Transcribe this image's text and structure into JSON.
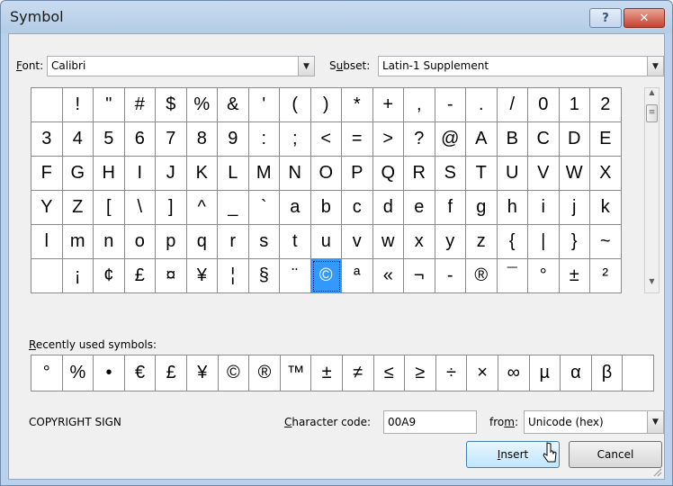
{
  "window": {
    "title": "Symbol",
    "help_glyph": "?",
    "close_glyph": "✕"
  },
  "font": {
    "label_u": "F",
    "label_rest": "ont:",
    "value": "Calibri"
  },
  "subset": {
    "label_pre": "S",
    "label_u": "u",
    "label_rest": "bset:",
    "value": "Latin-1 Supplement"
  },
  "symbol_grid": [
    [
      " ",
      "!",
      "\"",
      "#",
      "$",
      "%",
      "&",
      "'",
      "(",
      ")",
      "*",
      "+",
      ",",
      "-",
      ".",
      "/",
      "0",
      "1",
      "2"
    ],
    [
      "3",
      "4",
      "5",
      "6",
      "7",
      "8",
      "9",
      ":",
      ";",
      "<",
      "=",
      ">",
      "?",
      "@",
      "A",
      "B",
      "C",
      "D",
      "E"
    ],
    [
      "F",
      "G",
      "H",
      "I",
      "J",
      "K",
      "L",
      "M",
      "N",
      "O",
      "P",
      "Q",
      "R",
      "S",
      "T",
      "U",
      "V",
      "W",
      "X"
    ],
    [
      "Y",
      "Z",
      "[",
      "\\",
      "]",
      "^",
      "_",
      "`",
      "a",
      "b",
      "c",
      "d",
      "e",
      "f",
      "g",
      "h",
      "i",
      "j",
      "k"
    ],
    [
      "l",
      "m",
      "n",
      "o",
      "p",
      "q",
      "r",
      "s",
      "t",
      "u",
      "v",
      "w",
      "x",
      "y",
      "z",
      "{",
      "|",
      "}",
      "~"
    ],
    [
      " ",
      "¡",
      "¢",
      "£",
      "¤",
      "¥",
      "¦",
      "§",
      "¨",
      "©",
      "ª",
      "«",
      "¬",
      "-",
      "®",
      "¯",
      "°",
      "±",
      "²"
    ]
  ],
  "selected_symbol": "©",
  "recent": {
    "label_u": "R",
    "label_rest": "ecently used symbols:",
    "symbols": [
      "°",
      "%",
      "•",
      "€",
      "£",
      "¥",
      "©",
      "®",
      "™",
      "±",
      "≠",
      "≤",
      "≥",
      "÷",
      "×",
      "∞",
      "µ",
      "α",
      "β",
      " "
    ]
  },
  "character_name": "COPYRIGHT SIGN",
  "char_code": {
    "label_u": "C",
    "label_rest": "haracter code:",
    "value": "00A9"
  },
  "from": {
    "label_pre": "fro",
    "label_u": "m",
    "label_rest": ":",
    "value": "Unicode (hex)"
  },
  "buttons": {
    "insert_u": "I",
    "insert_rest": "nsert",
    "cancel": "Cancel"
  },
  "icons": {
    "dropdown": "chevron-down-icon",
    "scroll_up": "scroll-up-arrow-icon",
    "scroll_down": "scroll-down-arrow-icon",
    "cursor": "mouse-pointer-icon"
  }
}
